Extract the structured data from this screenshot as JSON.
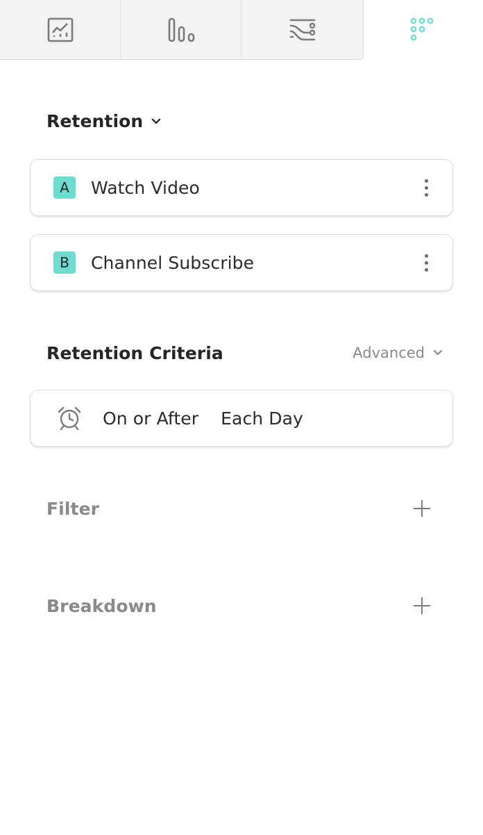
{
  "tabs": [
    {
      "name": "insights",
      "icon": "line-chart-icon"
    },
    {
      "name": "funnels",
      "icon": "bar-chart-icon"
    },
    {
      "name": "flows",
      "icon": "flows-icon"
    },
    {
      "name": "retention",
      "icon": "retention-grid-icon",
      "active": true
    }
  ],
  "header": {
    "title": "Retention"
  },
  "events": [
    {
      "badge": "A",
      "label": "Watch Video"
    },
    {
      "badge": "B",
      "label": "Channel Subscribe"
    }
  ],
  "criteria": {
    "title": "Retention Criteria",
    "advanced_label": "Advanced",
    "condition": "On or After",
    "interval": "Each Day"
  },
  "filter": {
    "title": "Filter"
  },
  "breakdown": {
    "title": "Breakdown"
  },
  "colors": {
    "accent": "#6fdcd2",
    "tab_bg": "#f3f3f3",
    "icon_gray": "#7a7a7a",
    "active_icon": "#6fdcd2"
  }
}
